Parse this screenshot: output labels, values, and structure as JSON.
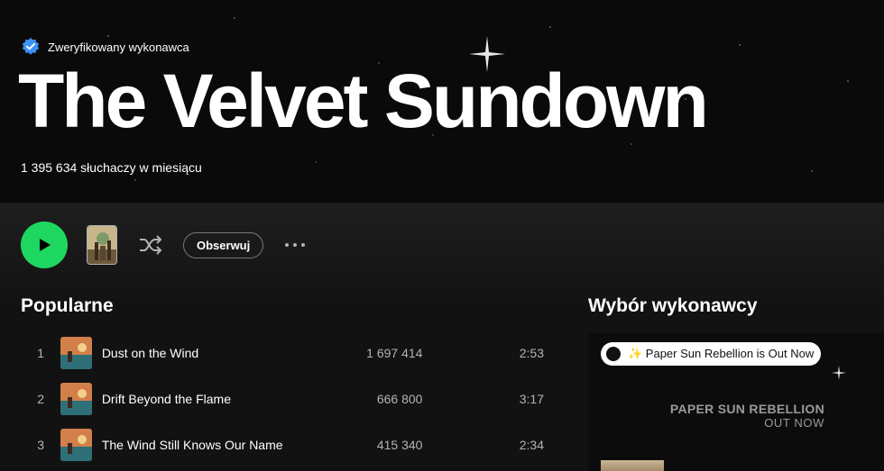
{
  "artist": {
    "verified_label": "Zweryfikowany wykonawca",
    "name": "The Velvet Sundown",
    "monthly_listeners": "1 395 634 słuchaczy w miesiącu"
  },
  "actions": {
    "follow_label": "Obserwuj"
  },
  "popular": {
    "title": "Popularne",
    "tracks": [
      {
        "num": "1",
        "title": "Dust on the Wind",
        "plays": "1 697 414",
        "duration": "2:53"
      },
      {
        "num": "2",
        "title": "Drift Beyond the Flame",
        "plays": "666 800",
        "duration": "3:17"
      },
      {
        "num": "3",
        "title": "The Wind Still Knows Our Name",
        "plays": "415 340",
        "duration": "2:34"
      }
    ]
  },
  "artist_pick": {
    "title": "Wybór wykonawcy",
    "badge": "✨ Paper Sun Rebellion is Out Now",
    "headline": "PAPER SUN REBELLION",
    "subline": "OUT NOW"
  },
  "colors": {
    "accent": "#1ed760",
    "verified": "#3d91f4",
    "background": "#121212"
  },
  "icons": [
    "verified-badge-icon",
    "play-icon",
    "shuffle-icon",
    "more-options-icon"
  ]
}
